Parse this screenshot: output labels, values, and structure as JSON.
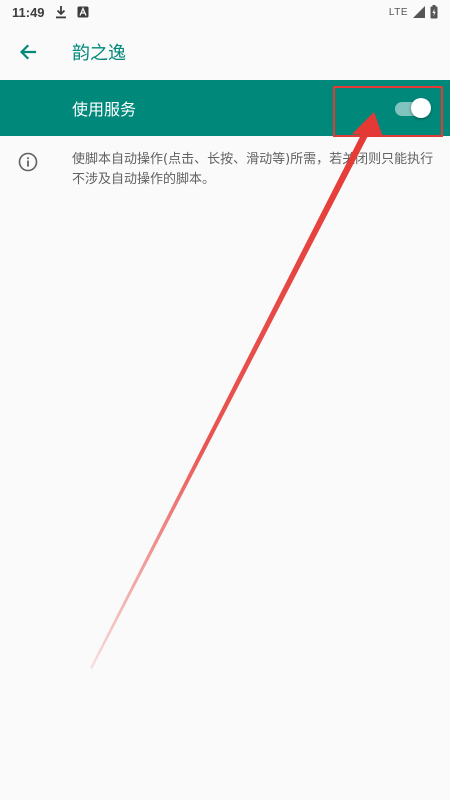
{
  "status_bar": {
    "time": "11:49",
    "network": "LTE",
    "icons": [
      "download-icon",
      "notification-a-icon",
      "signal-icon",
      "battery-charging-icon"
    ]
  },
  "app_bar": {
    "title": "韵之逸",
    "back_icon": "arrow-left-icon"
  },
  "master_switch": {
    "label": "使用服务",
    "enabled": true
  },
  "info": {
    "icon": "info-icon",
    "text": "使脚本自动操作(点击、长按、滑动等)所需，若关闭则只能执行不涉及自动操作的脚本。"
  },
  "colors": {
    "accent": "#00897b",
    "background": "#fafafa",
    "annotation": "#e53935"
  }
}
